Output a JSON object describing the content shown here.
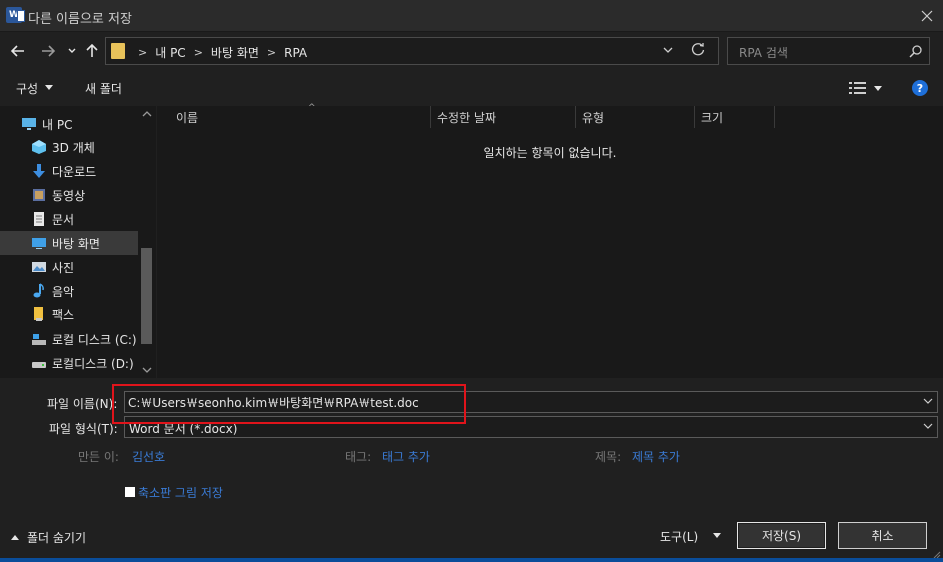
{
  "window": {
    "title": "다른 이름으로 저장",
    "app_icon_letter": "W"
  },
  "address": {
    "crumbs": [
      "내 PC",
      "바탕 화면",
      "RPA"
    ]
  },
  "search": {
    "placeholder": "RPA 검색"
  },
  "toolbar": {
    "organize_label": "구성",
    "new_folder_label": "새 폴더",
    "help_label": "?"
  },
  "nav": {
    "items": [
      {
        "label": "내 PC",
        "icon": "pc-icon"
      },
      {
        "label": "3D 개체",
        "icon": "3d-objects-icon"
      },
      {
        "label": "다운로드",
        "icon": "download-icon"
      },
      {
        "label": "동영상",
        "icon": "video-icon"
      },
      {
        "label": "문서",
        "icon": "document-icon"
      },
      {
        "label": "바탕 화면",
        "icon": "desktop-icon"
      },
      {
        "label": "사진",
        "icon": "picture-icon"
      },
      {
        "label": "음악",
        "icon": "music-icon"
      },
      {
        "label": "팩스",
        "icon": "fax-icon"
      },
      {
        "label": "로컬 디스크 (C:)",
        "icon": "drive-c-icon"
      },
      {
        "label": "로컬디스크 (D:)",
        "icon": "drive-d-icon"
      }
    ],
    "selected": "바탕 화면"
  },
  "filelist": {
    "columns": [
      "이름",
      "수정한 날짜",
      "유형",
      "크기"
    ],
    "empty_message": "일치하는 항목이 없습니다."
  },
  "form": {
    "filename_label": "파일 이름(N):",
    "filename_value": "C:￦Users￦seonho.kim￦바탕화면￦RPA￦test.doc",
    "filetype_label": "파일 형식(T):",
    "filetype_value": "Word 문서 (*.docx)",
    "author_label": "만든 이:",
    "author_value": "김선호",
    "tags_label": "태그:",
    "tags_value": "태그 추가",
    "title_label": "제목:",
    "title_value": "제목 추가",
    "thumbnail_label": "축소판 그림 저장",
    "thumbnail_checked": false
  },
  "footer": {
    "hide_folders_label": "폴더 숨기기",
    "tools_label": "도구(L)",
    "save_label": "저장(S)",
    "cancel_label": "취소"
  },
  "colors": {
    "accent": "#1e6fd9",
    "link": "#3a7bd5",
    "highlight_box": "#e0141b",
    "background": "#202020"
  }
}
